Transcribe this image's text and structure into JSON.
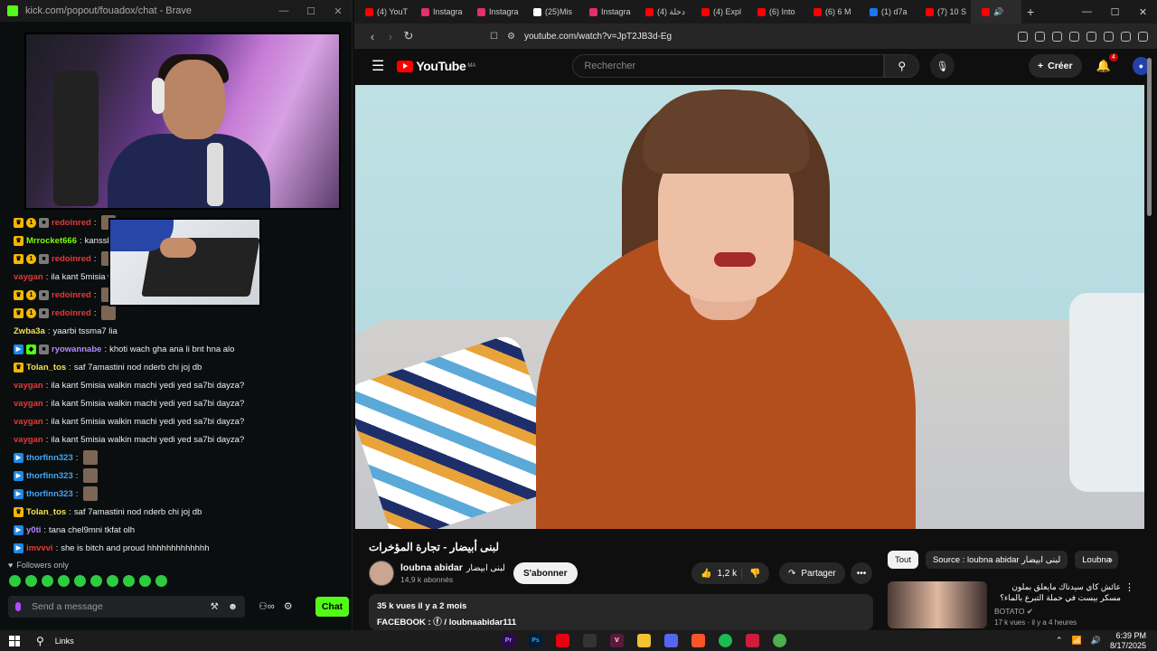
{
  "kick_window": {
    "title": "kick.com/popout/fouadox/chat - Brave",
    "controls": [
      "—",
      "☐",
      "✕"
    ]
  },
  "chat": {
    "messages": [
      {
        "badges": [
          "crown",
          "sub",
          "mod"
        ],
        "user": "redoinred",
        "user_color": "#e53935",
        "text": "",
        "emote": true
      },
      {
        "badges": [
          "crown"
        ],
        "user": "Mrrocket666",
        "user_color": "#7CFC00",
        "text": "kanssl",
        "emote": false
      },
      {
        "badges": [
          "crown",
          "sub",
          "mod"
        ],
        "user": "redoinred",
        "user_color": "#e53935",
        "text": "",
        "emote": true
      },
      {
        "badges": [],
        "user": "vaygan",
        "user_color": "#e53935",
        "text": "ila kant 5misia w",
        "emote": false
      },
      {
        "badges": [
          "crown",
          "sub",
          "mod"
        ],
        "user": "redoinred",
        "user_color": "#e53935",
        "text": "",
        "emote": true
      },
      {
        "badges": [
          "crown",
          "sub",
          "mod"
        ],
        "user": "redoinred",
        "user_color": "#e53935",
        "text": "",
        "emote": true
      },
      {
        "badges": [],
        "user": "Zwba3a",
        "user_color": "#f2e34b",
        "text": "yaarbi tssma7 lia",
        "emote": false
      },
      {
        "badges": [
          "vip",
          "gift",
          "mod"
        ],
        "user": "ryowannabe",
        "user_color": "#b388ff",
        "text": "khoti wach gha ana li bnt hna alo",
        "emote": false
      },
      {
        "badges": [
          "crown"
        ],
        "user": "Tolan_tos",
        "user_color": "#f2e34b",
        "text": "saf 7amastini nod nderb chi joj db",
        "emote": false
      },
      {
        "badges": [],
        "user": "vaygan",
        "user_color": "#e53935",
        "text": "ila kant 5misia walkin machi yedi yed sa7bi dayza?",
        "emote": false
      },
      {
        "badges": [],
        "user": "vaygan",
        "user_color": "#e53935",
        "text": "ila kant 5misia walkin machi yedi yed sa7bi dayza?",
        "emote": false
      },
      {
        "badges": [],
        "user": "vaygan",
        "user_color": "#e53935",
        "text": "ila kant 5misia walkin machi yedi yed sa7bi dayza?",
        "emote": false
      },
      {
        "badges": [],
        "user": "vaygan",
        "user_color": "#e53935",
        "text": "ila kant 5misia walkin machi yedi yed sa7bi dayza?",
        "emote": false
      },
      {
        "badges": [
          "vip"
        ],
        "user": "thorfinn323",
        "user_color": "#42a5f5",
        "text": "",
        "emote": true
      },
      {
        "badges": [
          "vip"
        ],
        "user": "thorfinn323",
        "user_color": "#42a5f5",
        "text": "",
        "emote": true
      },
      {
        "badges": [
          "vip"
        ],
        "user": "thorfinn323",
        "user_color": "#42a5f5",
        "text": "",
        "emote": true
      },
      {
        "badges": [
          "crown"
        ],
        "user": "Tolan_tos",
        "user_color": "#f2e34b",
        "text": "saf 7amastini nod nderb chi joj db",
        "emote": false
      },
      {
        "badges": [
          "vip"
        ],
        "user": "y0ti",
        "user_color": "#b388ff",
        "text": "tana chel9mni tkfat olh",
        "emote": false
      },
      {
        "badges": [
          "vip"
        ],
        "user": "imvvvi",
        "user_color": "#e53935",
        "text": "she is bitch and proud hhhhhhhhhhhhh",
        "emote": false
      }
    ],
    "followers_only": "Followers only",
    "send_placeholder": "Send a message",
    "chat_button": "Chat"
  },
  "browser": {
    "tabs": [
      {
        "label": "(4) YouT",
        "color": "#ff0000"
      },
      {
        "label": "Instagra",
        "color": "#e1306c"
      },
      {
        "label": "Instagra",
        "color": "#e1306c"
      },
      {
        "label": "(25)Mis",
        "color": "#ffffff"
      },
      {
        "label": "Instagra",
        "color": "#e1306c"
      },
      {
        "label": "(4) دخلة",
        "color": "#ff0000"
      },
      {
        "label": "(4) Expl",
        "color": "#ff0000"
      },
      {
        "label": "(6) Into",
        "color": "#ff0000"
      },
      {
        "label": "(6) 6 M",
        "color": "#ff0000"
      },
      {
        "label": "(1) d7a",
        "color": "#1877f2"
      },
      {
        "label": "(7) 10 S",
        "color": "#ff0000"
      },
      {
        "label": "🔊",
        "color": "#ff0000"
      }
    ],
    "url": "youtube.com/watch?v=JpT2JB3d-Eg",
    "window_controls": [
      "—",
      "☐",
      "✕"
    ]
  },
  "youtube": {
    "logo_text": "YouTube",
    "region": "MA",
    "search_placeholder": "Rechercher",
    "create_label": "Créer",
    "notif_count": "4",
    "video_title": "لبنى أبيضار - تجارة المؤخرات",
    "channel_name": "loubna abidar",
    "channel_name_ar": "لبنى ابيضار",
    "subscribers": "14,9 k abonnés",
    "subscribe_label": "S'abonner",
    "likes": "1,2 k",
    "share_label": "Partager",
    "description_views": "35 k vues  il y a 2 mois",
    "description_line": "FACEBOOK : ⓕ / loubnaabidar111",
    "chips": [
      {
        "label": "Tout",
        "active": true
      },
      {
        "label": "Source : loubna abidar لبنى ابيضار",
        "active": false
      },
      {
        "label": "Loubna",
        "active": false
      }
    ],
    "recommendation": {
      "title": "عائش كاي سيدناك مايعلق بملون مسكر بيست في حملة التبرع بالماء؟",
      "channel": "BOTATO ✔",
      "meta": "17 k vues · il y a 4 heures"
    }
  },
  "taskbar": {
    "links_label": "Links",
    "time": "6:39 PM",
    "date": "8/17/2025"
  }
}
